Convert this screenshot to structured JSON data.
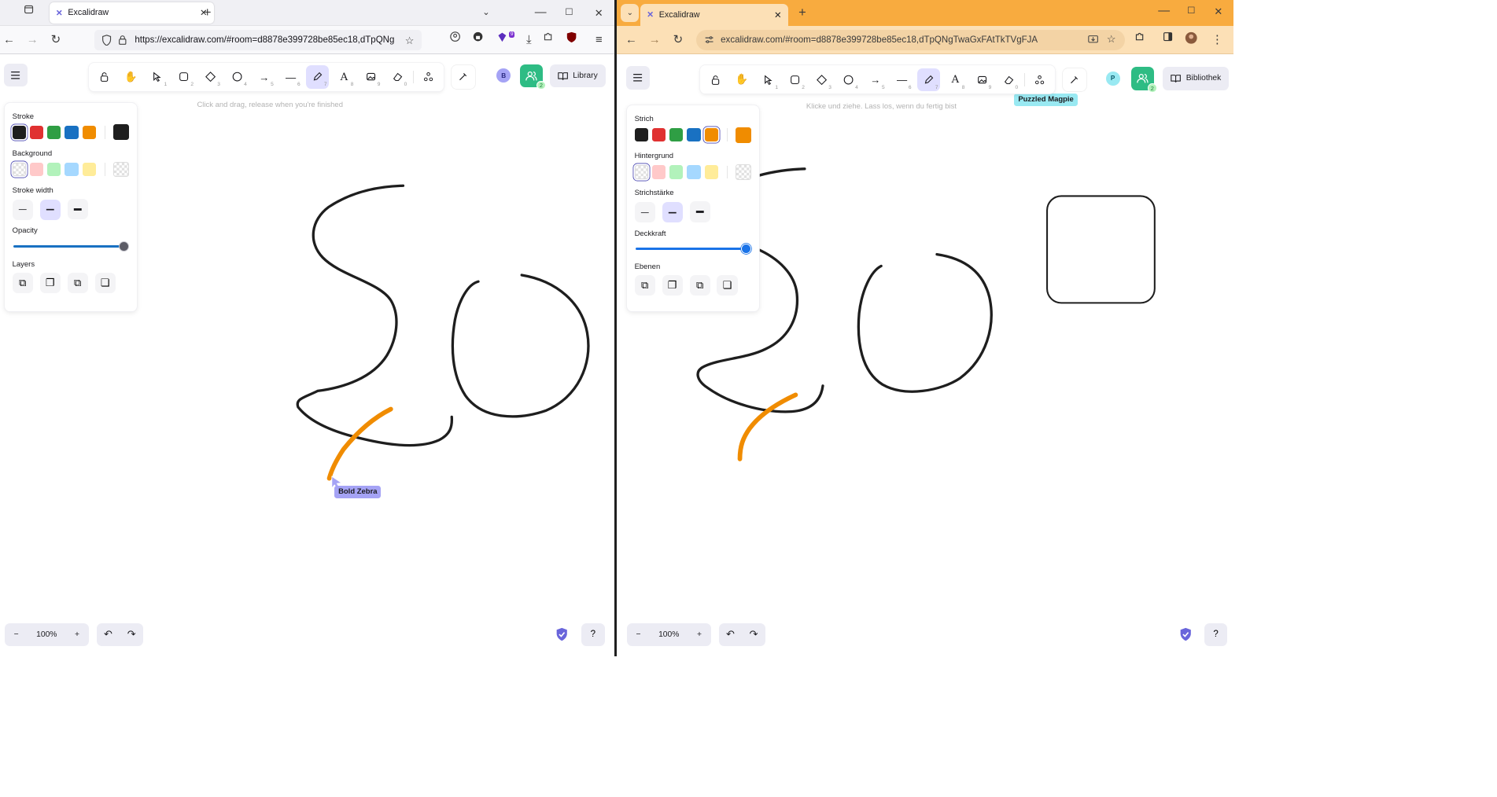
{
  "left_window": {
    "browser": "Firefox",
    "tab_title": "Excalidraw",
    "url": "https://excalidraw.com/#room=d8878e399728be85ec18,dTpQNg",
    "extension_badge": "9",
    "app": {
      "hint": "Click and drag, release when you're finished",
      "library_label": "Library",
      "avatar_letter": "B",
      "collab_count": "2",
      "panel": {
        "stroke_title": "Stroke",
        "background_title": "Background",
        "stroke_width_title": "Stroke width",
        "opacity_title": "Opacity",
        "layers_title": "Layers"
      },
      "zoom": "100%",
      "cursor_name": "Bold Zebra"
    }
  },
  "right_window": {
    "browser": "Chrome",
    "tab_title": "Excalidraw",
    "url": "excalidraw.com/#room=d8878e399728be85ec18,dTpQNgTwaGxFAtTkTVgFJA",
    "app": {
      "hint": "Klicke und ziehe. Lass los, wenn du fertig bist",
      "library_label": "Bibliothek",
      "avatar_letter": "P",
      "collab_count": "2",
      "panel": {
        "stroke_title": "Strich",
        "background_title": "Hintergrund",
        "stroke_width_title": "Strichstärke",
        "opacity_title": "Deckkraft",
        "layers_title": "Ebenen"
      },
      "zoom": "100%",
      "cursor_name": "Puzzled Magpie"
    }
  },
  "tool_keys": [
    "",
    "",
    "1",
    "2",
    "3",
    "4",
    "5",
    "6",
    "7",
    "8",
    "9",
    "0"
  ],
  "tool_icons": [
    "lock-icon",
    "hand-icon",
    "selection-icon",
    "rectangle-icon",
    "diamond-icon",
    "ellipse-icon",
    "arrow-icon",
    "line-icon",
    "pencil-icon",
    "text-icon",
    "image-icon",
    "eraser-icon",
    "extra-tools-icon",
    "laser-icon"
  ],
  "colors": {
    "stroke_swatches": [
      "#1e1e1e",
      "#e03131",
      "#2f9e44",
      "#1971c2",
      "#f08c00"
    ],
    "background_swatches": [
      "transparent",
      "#ffc9c9",
      "#b2f2bb",
      "#a5d8ff",
      "#ffec99"
    ],
    "left_current_stroke": "#1e1e1e",
    "right_current_stroke": "#f08c00",
    "accent": "#6965db",
    "active_tool_bg": "#e0dfff",
    "collab_green": "#2ebc84",
    "bold_zebra_label_bg": "#a5a3f5",
    "puzzled_magpie_label_bg": "#99e9f2",
    "firefox_tabbar": "#f0f0f4",
    "chrome_theme": "#f8ab3f"
  }
}
